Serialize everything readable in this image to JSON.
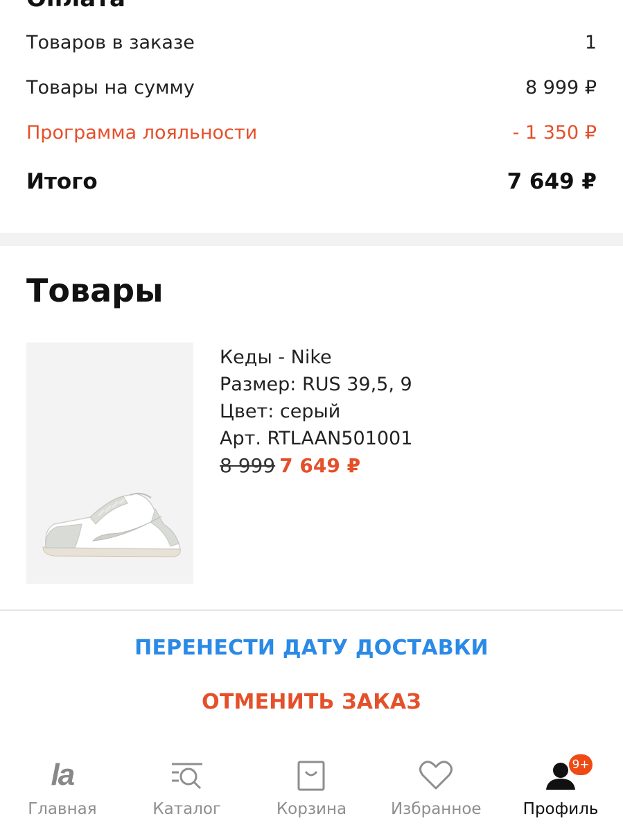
{
  "payment": {
    "title": "Оплата",
    "rows": [
      {
        "label": "Товаров в заказе",
        "value": "1"
      },
      {
        "label": "Товары на сумму",
        "value": "8 999 ₽"
      },
      {
        "label": "Программа лояльности",
        "value": "- 1 350 ₽"
      },
      {
        "label": "Итого",
        "value": "7 649 ₽"
      }
    ]
  },
  "products": {
    "title": "Товары",
    "item": {
      "name": "Кеды - Nike",
      "size": "Размер: RUS 39,5, 9",
      "color": "Цвет: серый",
      "article": "Арт. RTLAAN501001",
      "old_price": "8 999",
      "new_price": "7 649 ₽"
    }
  },
  "actions": {
    "reschedule": "ПЕРЕНЕСТИ ДАТУ ДОСТАВКИ",
    "cancel": "ОТМЕНИТЬ ЗАКАЗ"
  },
  "tabbar": {
    "items": [
      {
        "label": "Главная",
        "icon": "la-logo-icon"
      },
      {
        "label": "Каталог",
        "icon": "catalog-icon"
      },
      {
        "label": "Корзина",
        "icon": "cart-bag-icon"
      },
      {
        "label": "Избранное",
        "icon": "heart-icon"
      },
      {
        "label": "Профиль",
        "icon": "profile-icon"
      }
    ],
    "badge": "9+",
    "active_index": 4
  },
  "colors": {
    "accent_orange": "#e4502a",
    "link_blue": "#2a8ae6",
    "badge": "#f04a14"
  }
}
